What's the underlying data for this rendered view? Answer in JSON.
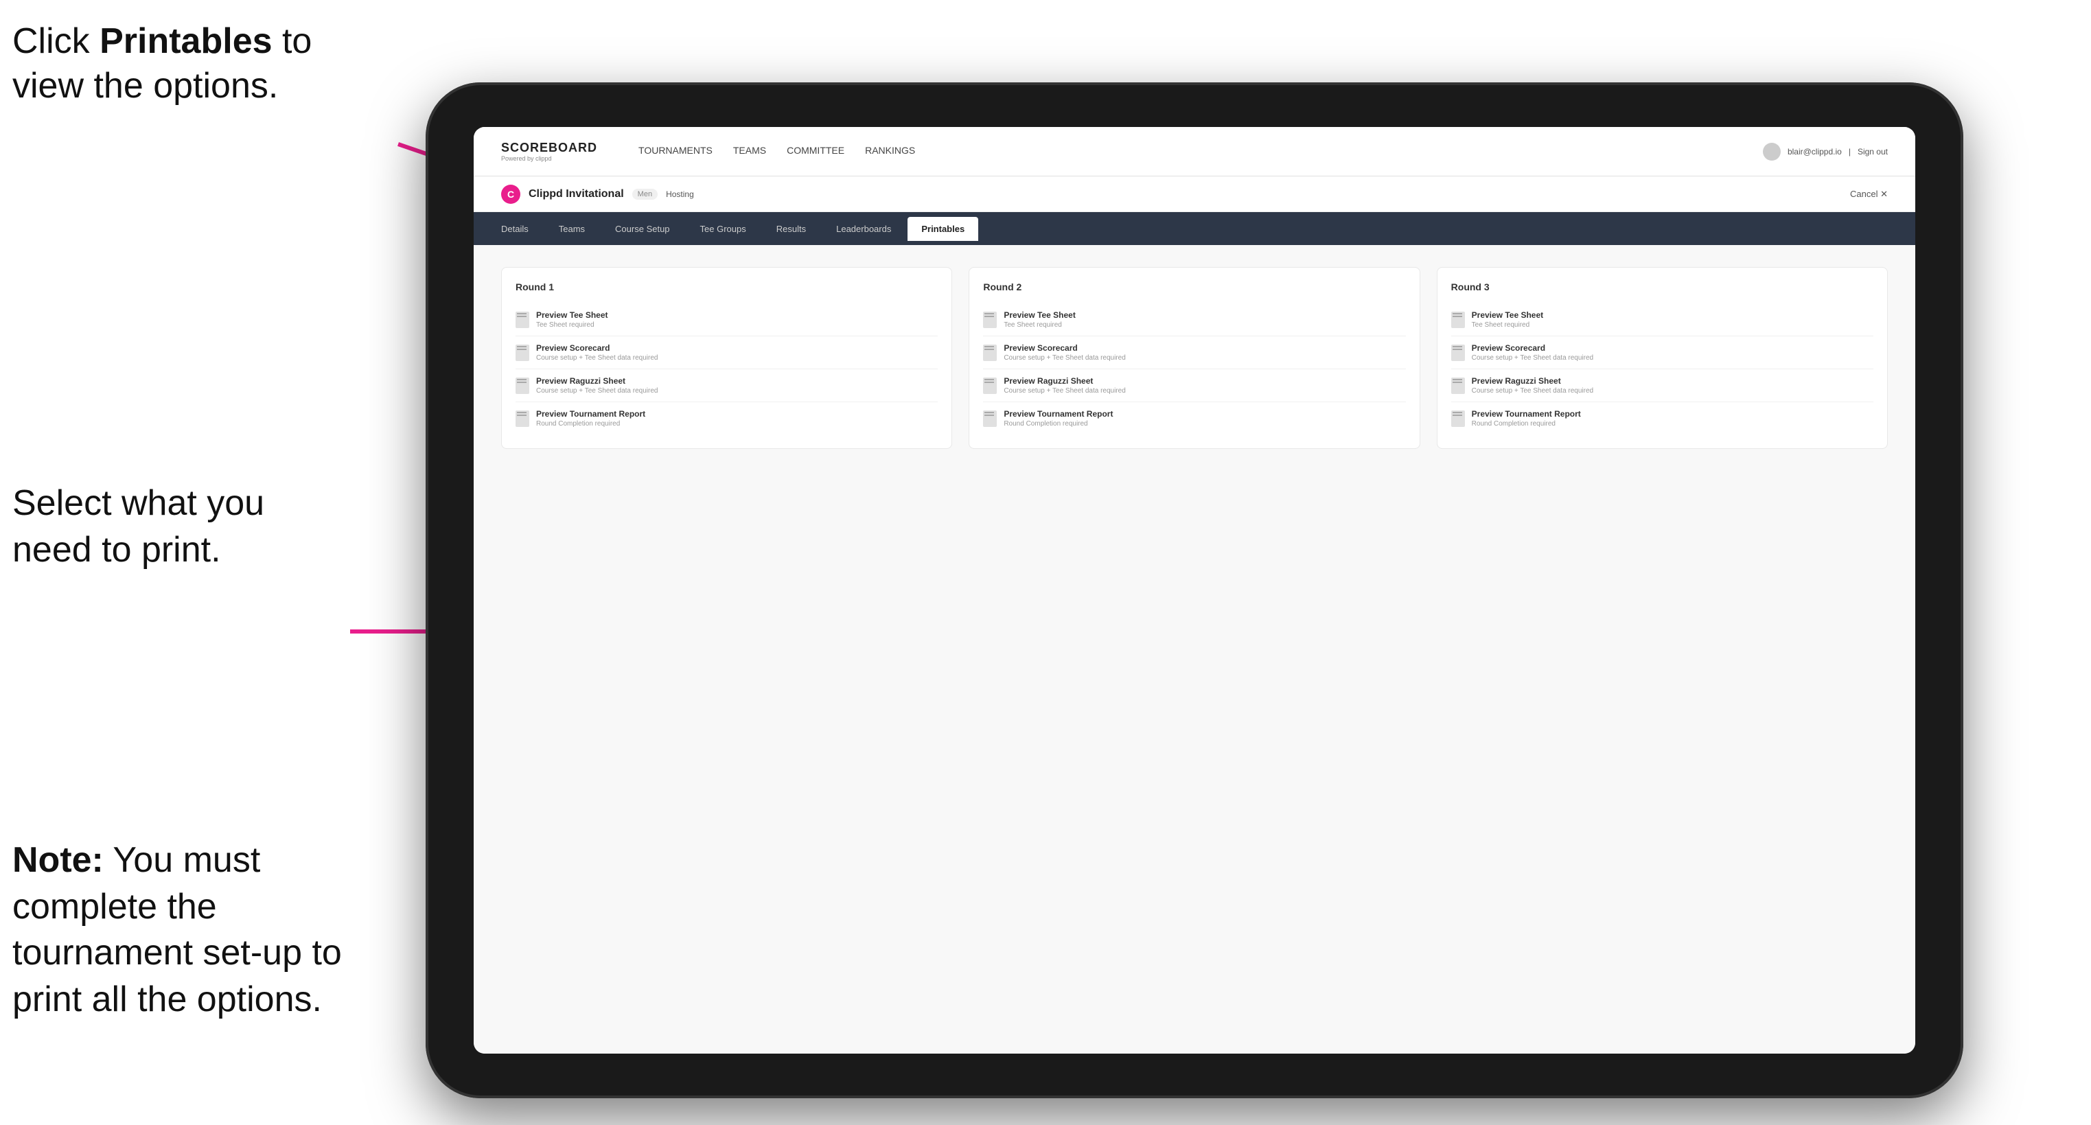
{
  "annotations": {
    "top": {
      "line1": "Click ",
      "bold": "Printables",
      "line2": " to",
      "line3": "view the options."
    },
    "middle": {
      "text": "Select what you need to print."
    },
    "bottom": {
      "bold": "Note:",
      "text": " You must complete the tournament set-up to print all the options."
    }
  },
  "nav": {
    "logo": "SCOREBOARD",
    "logo_sub": "Powered by clippd",
    "links": [
      {
        "label": "TOURNAMENTS",
        "active": false
      },
      {
        "label": "TEAMS",
        "active": false
      },
      {
        "label": "COMMITTEE",
        "active": false
      },
      {
        "label": "RANKINGS",
        "active": false
      }
    ],
    "user_email": "blair@clippd.io",
    "sign_out": "Sign out"
  },
  "sub_header": {
    "logo_letter": "C",
    "tournament_name": "Clippd Invitational",
    "badge": "Men",
    "hosting": "Hosting",
    "cancel": "Cancel ✕"
  },
  "tabs": [
    {
      "label": "Details",
      "active": false
    },
    {
      "label": "Teams",
      "active": false
    },
    {
      "label": "Course Setup",
      "active": false
    },
    {
      "label": "Tee Groups",
      "active": false
    },
    {
      "label": "Results",
      "active": false
    },
    {
      "label": "Leaderboards",
      "active": false
    },
    {
      "label": "Printables",
      "active": true
    }
  ],
  "rounds": [
    {
      "title": "Round 1",
      "items": [
        {
          "title": "Preview Tee Sheet",
          "sub": "Tee Sheet required"
        },
        {
          "title": "Preview Scorecard",
          "sub": "Course setup + Tee Sheet data required"
        },
        {
          "title": "Preview Raguzzi Sheet",
          "sub": "Course setup + Tee Sheet data required"
        },
        {
          "title": "Preview Tournament Report",
          "sub": "Round Completion required"
        }
      ]
    },
    {
      "title": "Round 2",
      "items": [
        {
          "title": "Preview Tee Sheet",
          "sub": "Tee Sheet required"
        },
        {
          "title": "Preview Scorecard",
          "sub": "Course setup + Tee Sheet data required"
        },
        {
          "title": "Preview Raguzzi Sheet",
          "sub": "Course setup + Tee Sheet data required"
        },
        {
          "title": "Preview Tournament Report",
          "sub": "Round Completion required"
        }
      ]
    },
    {
      "title": "Round 3",
      "items": [
        {
          "title": "Preview Tee Sheet",
          "sub": "Tee Sheet required"
        },
        {
          "title": "Preview Scorecard",
          "sub": "Course setup + Tee Sheet data required"
        },
        {
          "title": "Preview Raguzzi Sheet",
          "sub": "Course setup + Tee Sheet data required"
        },
        {
          "title": "Preview Tournament Report",
          "sub": "Round Completion required"
        }
      ]
    }
  ]
}
